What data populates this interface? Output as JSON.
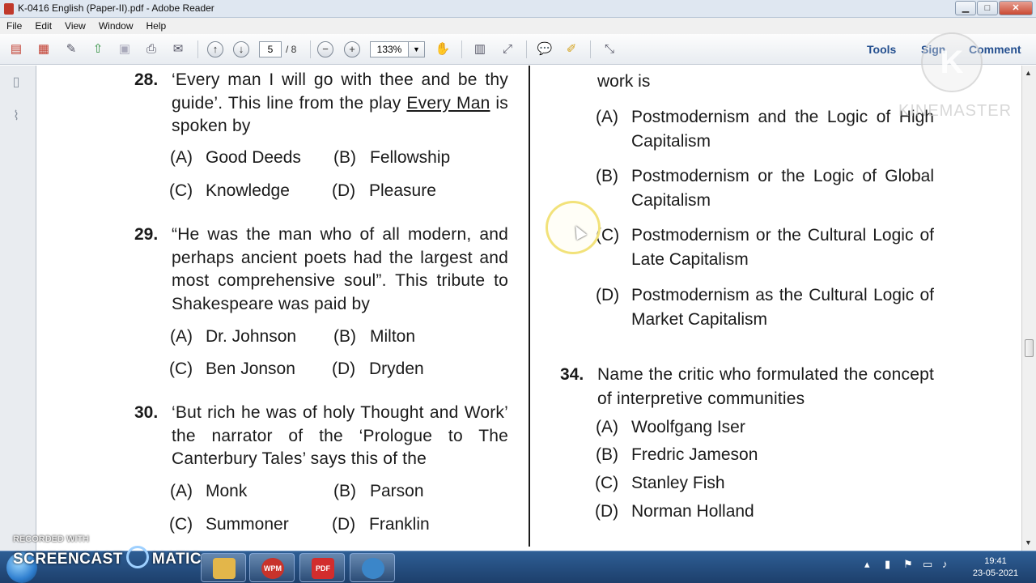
{
  "window": {
    "title": "K-0416 English (Paper-II).pdf - Adobe Reader",
    "minimize": "▁",
    "maximize": "□",
    "close": "✕"
  },
  "menu": [
    "File",
    "Edit",
    "View",
    "Window",
    "Help"
  ],
  "toolbar": {
    "page_current": "5",
    "page_total": "/ 8",
    "zoom": "133%",
    "zoom_dropdown": "▼",
    "zoom_out": "−",
    "zoom_in": "+",
    "tools_label": "Tools",
    "sign_label": "Sign",
    "comment_label": "Comment",
    "icons": [
      "create-pdf-icon",
      "export-pdf-icon",
      "edit-icon",
      "upload-icon",
      "save-icon",
      "print-icon",
      "email-icon",
      "prev-page-icon",
      "next-page-icon",
      "select-tool-icon",
      "fit-page-icon",
      "fit-width-icon",
      "comment-icon",
      "highlight-icon",
      "fullscreen-icon"
    ]
  },
  "document": {
    "left": [
      {
        "num": "28.",
        "text_before": "‘Every man I will go with thee and be thy guide’. This line from the play ",
        "text_underline": "Every Man",
        "text_after": "  is spoken by",
        "options": [
          {
            "letter": "(A)",
            "text": "Good Deeds"
          },
          {
            "letter": "(B)",
            "text": "Fellowship"
          },
          {
            "letter": "(C)",
            "text": "Knowledge"
          },
          {
            "letter": "(D)",
            "text": "Pleasure"
          }
        ]
      },
      {
        "num": "29.",
        "text": "“He was the man who of all modern, and perhaps ancient poets had the largest and most comprehensive soul”. This tribute to Shakespeare was paid by",
        "options": [
          {
            "letter": "(A)",
            "text": "Dr. Johnson"
          },
          {
            "letter": "(B)",
            "text": "Milton"
          },
          {
            "letter": "(C)",
            "text": "Ben Jonson"
          },
          {
            "letter": "(D)",
            "text": "Dryden"
          }
        ]
      },
      {
        "num": "30.",
        "text": "‘But rich he was of holy Thought and Work’ the narrator of the ‘Prologue to The Canterbury Tales’ says this of the",
        "options": [
          {
            "letter": "(A)",
            "text": "Monk"
          },
          {
            "letter": "(B)",
            "text": "Parson"
          },
          {
            "letter": "(C)",
            "text": "Summoner"
          },
          {
            "letter": "(D)",
            "text": "Franklin"
          }
        ]
      }
    ],
    "right": {
      "q33_tail": "work is",
      "q33_options": [
        {
          "letter": "(A)",
          "text": "Postmodernism and the Logic of High Capitalism"
        },
        {
          "letter": "(B)",
          "text": "Postmodernism or the Logic of Global Capitalism"
        },
        {
          "letter": "(C)",
          "text": "Postmodernism or the Cultural Logic of Late Capitalism"
        },
        {
          "letter": "(D)",
          "text": "Postmodernism as the Cultural Logic of Market Capitalism"
        }
      ],
      "q34": {
        "num": "34.",
        "text": "Name the critic who formulated the concept of interpretive communities",
        "options": [
          {
            "letter": "(A)",
            "text": "Woolfgang Iser"
          },
          {
            "letter": "(B)",
            "text": "Fredric Jameson"
          },
          {
            "letter": "(C)",
            "text": "Stanley Fish"
          },
          {
            "letter": "(D)",
            "text": "Norman Holland"
          }
        ]
      }
    }
  },
  "watermarks": {
    "kinemaster_logo": "K",
    "kinemaster_text": "KINEMASTER",
    "recorded_with": "RECORDED WITH",
    "screencast_a": "SCREENCAST",
    "screencast_b": "MATIC"
  },
  "taskbar": {
    "apps": [
      {
        "name": "file-explorer-icon",
        "label": ""
      },
      {
        "name": "wpm-icon",
        "label": "WPM"
      },
      {
        "name": "adobe-reader-icon",
        "label": "PDF"
      },
      {
        "name": "screencast-icon",
        "label": ""
      }
    ],
    "clock_time": "19:41",
    "clock_date": "23-05-2021"
  }
}
